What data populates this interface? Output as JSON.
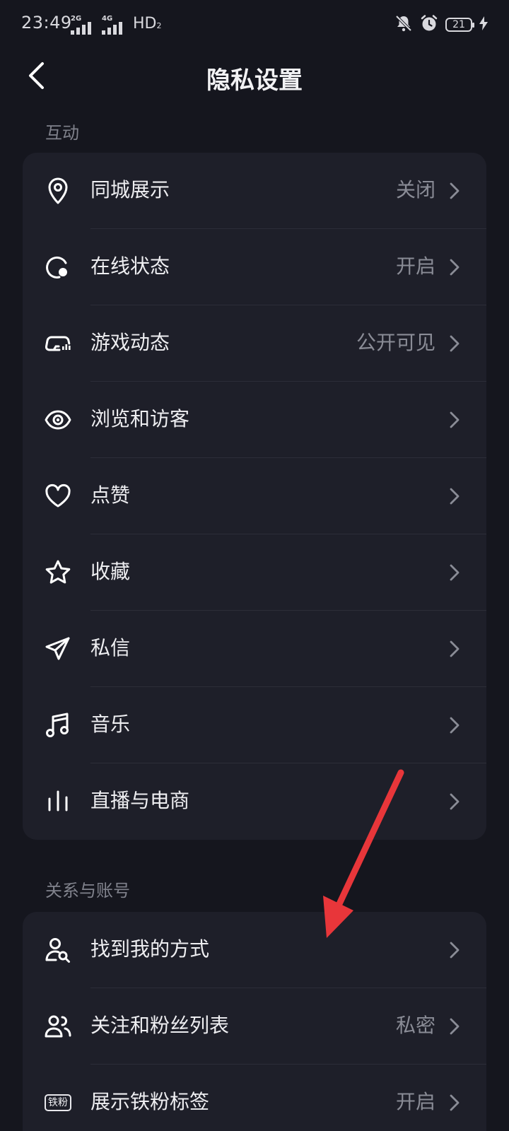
{
  "status_bar": {
    "time": "23:49",
    "sim1_network": "2G",
    "sim2_network": "4G",
    "hd_label": "HD",
    "hd_sub": "2",
    "battery_level": "21"
  },
  "header": {
    "title": "隐私设置"
  },
  "sections": [
    {
      "label": "互动",
      "items": [
        {
          "label": "同城展示",
          "value": "关闭",
          "icon": "location-pin-icon"
        },
        {
          "label": "在线状态",
          "value": "开启",
          "icon": "online-status-icon"
        },
        {
          "label": "游戏动态",
          "value": "公开可见",
          "icon": "game-controller-icon"
        },
        {
          "label": "浏览和访客",
          "value": "",
          "icon": "eye-icon"
        },
        {
          "label": "点赞",
          "value": "",
          "icon": "heart-icon"
        },
        {
          "label": "收藏",
          "value": "",
          "icon": "star-icon"
        },
        {
          "label": "私信",
          "value": "",
          "icon": "paper-plane-icon"
        },
        {
          "label": "音乐",
          "value": "",
          "icon": "music-note-icon"
        },
        {
          "label": "直播与电商",
          "value": "",
          "icon": "live-bars-icon"
        }
      ]
    },
    {
      "label": "关系与账号",
      "items": [
        {
          "label": "找到我的方式",
          "value": "",
          "icon": "user-search-icon"
        },
        {
          "label": "关注和粉丝列表",
          "value": "私密",
          "icon": "users-icon"
        },
        {
          "label": "展示铁粉标签",
          "value": "开启",
          "icon": "fan-badge-icon",
          "badge_text": "铁粉"
        }
      ]
    }
  ],
  "colors": {
    "background": "#15161e",
    "card": "#1e1f29",
    "annotation_arrow": "#e8363a"
  }
}
